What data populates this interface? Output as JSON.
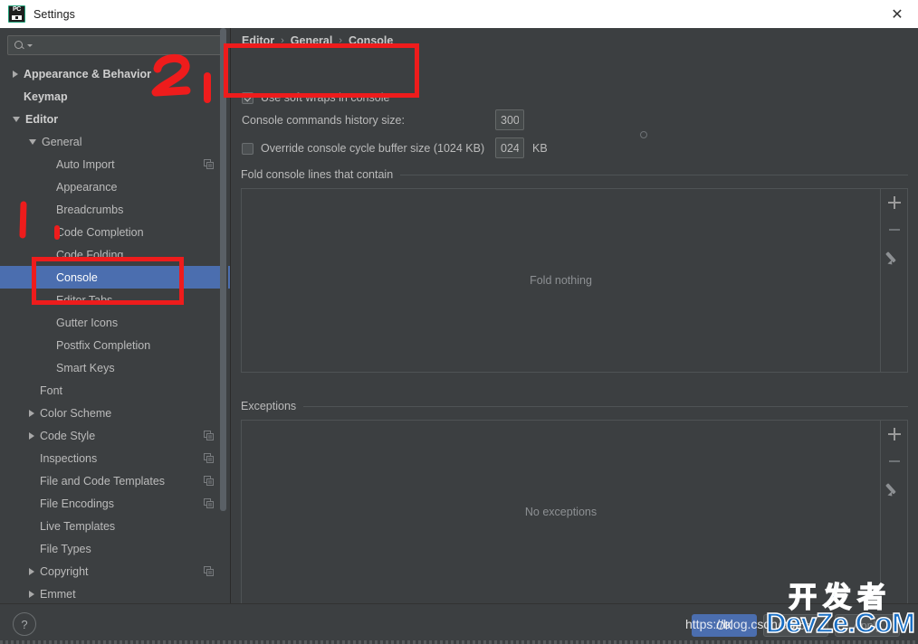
{
  "window": {
    "title": "Settings",
    "app_icon": "pycharm-icon",
    "close_label": "✕"
  },
  "sidebar": {
    "search": {
      "value": "",
      "placeholder": ""
    },
    "items": [
      {
        "label": "Appearance & Behavior",
        "arrow": "right",
        "indent": 0,
        "bold": true,
        "copy": false,
        "selected": false
      },
      {
        "label": "Keymap",
        "arrow": "none",
        "indent": 0,
        "bold": true,
        "copy": false,
        "selected": false
      },
      {
        "label": "Editor",
        "arrow": "down",
        "indent": 0,
        "bold": true,
        "copy": false,
        "selected": false
      },
      {
        "label": "General",
        "arrow": "down",
        "indent": 1,
        "bold": false,
        "copy": false,
        "selected": false
      },
      {
        "label": "Auto Import",
        "arrow": "none",
        "indent": 2,
        "bold": false,
        "copy": true,
        "selected": false
      },
      {
        "label": "Appearance",
        "arrow": "none",
        "indent": 2,
        "bold": false,
        "copy": false,
        "selected": false
      },
      {
        "label": "Breadcrumbs",
        "arrow": "none",
        "indent": 2,
        "bold": false,
        "copy": false,
        "selected": false
      },
      {
        "label": "Code Completion",
        "arrow": "none",
        "indent": 2,
        "bold": false,
        "copy": false,
        "selected": false
      },
      {
        "label": "Code Folding",
        "arrow": "none",
        "indent": 2,
        "bold": false,
        "copy": false,
        "selected": false
      },
      {
        "label": "Console",
        "arrow": "none",
        "indent": 2,
        "bold": false,
        "copy": false,
        "selected": true
      },
      {
        "label": "Editor Tabs",
        "arrow": "none",
        "indent": 2,
        "bold": false,
        "copy": false,
        "selected": false
      },
      {
        "label": "Gutter Icons",
        "arrow": "none",
        "indent": 2,
        "bold": false,
        "copy": false,
        "selected": false
      },
      {
        "label": "Postfix Completion",
        "arrow": "none",
        "indent": 2,
        "bold": false,
        "copy": false,
        "selected": false
      },
      {
        "label": "Smart Keys",
        "arrow": "none",
        "indent": 2,
        "bold": false,
        "copy": false,
        "selected": false
      },
      {
        "label": "Font",
        "arrow": "none",
        "indent": 1,
        "bold": false,
        "copy": false,
        "selected": false
      },
      {
        "label": "Color Scheme",
        "arrow": "right",
        "indent": 1,
        "bold": false,
        "copy": false,
        "selected": false
      },
      {
        "label": "Code Style",
        "arrow": "right",
        "indent": 1,
        "bold": false,
        "copy": true,
        "selected": false
      },
      {
        "label": "Inspections",
        "arrow": "none",
        "indent": 1,
        "bold": false,
        "copy": true,
        "selected": false
      },
      {
        "label": "File and Code Templates",
        "arrow": "none",
        "indent": 1,
        "bold": false,
        "copy": true,
        "selected": false
      },
      {
        "label": "File Encodings",
        "arrow": "none",
        "indent": 1,
        "bold": false,
        "copy": true,
        "selected": false
      },
      {
        "label": "Live Templates",
        "arrow": "none",
        "indent": 1,
        "bold": false,
        "copy": false,
        "selected": false
      },
      {
        "label": "File Types",
        "arrow": "none",
        "indent": 1,
        "bold": false,
        "copy": false,
        "selected": false
      },
      {
        "label": "Copyright",
        "arrow": "right",
        "indent": 1,
        "bold": false,
        "copy": true,
        "selected": false
      },
      {
        "label": "Emmet",
        "arrow": "right",
        "indent": 1,
        "bold": false,
        "copy": false,
        "selected": false
      }
    ]
  },
  "main": {
    "breadcrumb": {
      "part1": "Editor",
      "part2": "General",
      "part3": "Console",
      "sep": "›"
    },
    "soft_wraps": {
      "label": "Use soft wraps in console",
      "checked": true
    },
    "history": {
      "label": "Console commands history size:",
      "value": "300"
    },
    "cycle_buffer": {
      "label": "Override console cycle buffer size (1024 KB)",
      "checked": false,
      "value": "024",
      "unit": "KB"
    },
    "fold_group": {
      "title": "Fold console lines that contain",
      "empty_text": "Fold nothing"
    },
    "exceptions_group": {
      "title": "Exceptions",
      "empty_text": "No exceptions"
    },
    "list_actions": {
      "add": "+",
      "remove": "−",
      "edit": "pencil"
    }
  },
  "bottom": {
    "help": "?",
    "ok": "OK",
    "cancel": "Cancel",
    "apply": "Apply"
  },
  "watermark": {
    "url": "https://blog.csdn.net",
    "brand_cn": "开发者",
    "brand_en": "DevZe.CoM"
  },
  "annotations": {
    "accent_color": "#ee1c1c",
    "marks": [
      "digit-2-mark",
      "digit-1-mark",
      "vertical-stroke",
      "dot-stroke"
    ]
  }
}
